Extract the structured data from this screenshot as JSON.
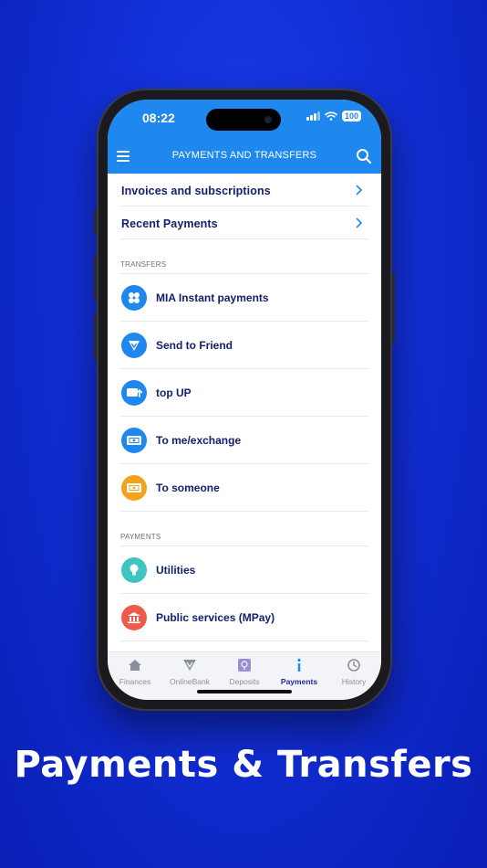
{
  "status": {
    "time": "08:22",
    "battery": "100"
  },
  "appbar": {
    "title": "PAYMENTS AND TRANSFERS"
  },
  "top_rows": [
    {
      "label": "Invoices and subscriptions"
    },
    {
      "label": "Recent Payments"
    }
  ],
  "sections": {
    "transfers": "TRANSFERS",
    "payments": "PAYMENTS"
  },
  "transfers": [
    {
      "label": "MIA Instant payments",
      "icon": "mia-icon",
      "color": "#1e88ee"
    },
    {
      "label": "Send to Friend",
      "icon": "send-friend-icon",
      "color": "#1e88ee"
    },
    {
      "label": "top UP",
      "icon": "top-up-icon",
      "color": "#1e88ee"
    },
    {
      "label": "To me/exchange",
      "icon": "exchange-icon",
      "color": "#1e88ee"
    },
    {
      "label": "To someone",
      "icon": "to-someone-icon",
      "color": "#f3a21c"
    }
  ],
  "payments": [
    {
      "label": "Utilities",
      "icon": "lightbulb-icon",
      "color": "#3cc6bf"
    },
    {
      "label": "Public services (MPay)",
      "icon": "bank-icon",
      "color": "#ee5b4b"
    }
  ],
  "tabbar": [
    {
      "label": "Finances",
      "icon": "home-icon"
    },
    {
      "label": "OnlineBank",
      "icon": "onlinebank-icon"
    },
    {
      "label": "Deposits",
      "icon": "deposits-icon"
    },
    {
      "label": "Payments",
      "icon": "info-icon",
      "active": true
    },
    {
      "label": "History",
      "icon": "history-icon"
    }
  ],
  "headline": "Payments & Transfers",
  "colors": {
    "accent": "#1e88ee",
    "text": "#14206b",
    "background": "#1230d8"
  }
}
